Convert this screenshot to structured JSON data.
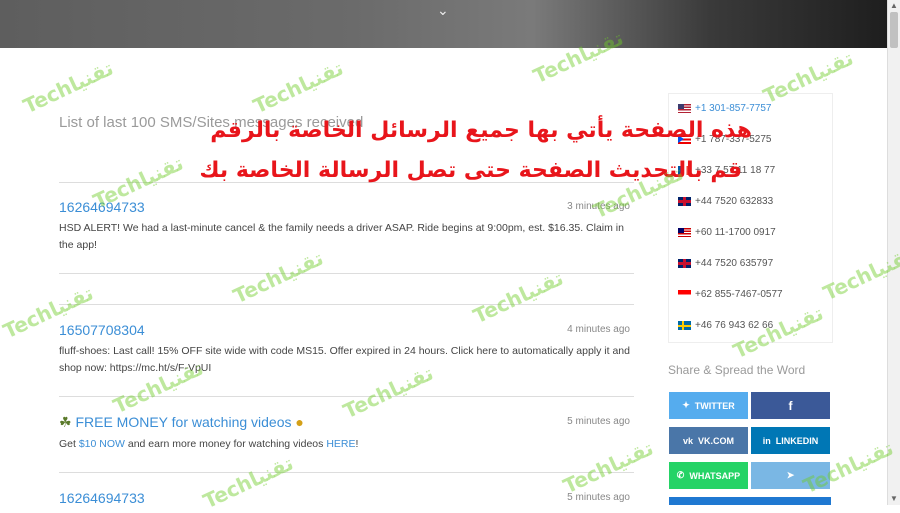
{
  "list_title": "List of last 100 SMS/Sites messages received",
  "overlay": {
    "line1": "هذه الصفحة يأتي بها جميع الرسائل الخاصة بالرقم",
    "line2": "قم بالتحديث الصفحة حتى تصل الرسالة الخاصة بك"
  },
  "messages": [
    {
      "number": "16264694733",
      "time": "3 minutes ago",
      "text": "HSD ALERT! We had a last-minute cancel & the family needs a driver ASAP. Ride begins at 9:00pm, est. $16.35. Claim in the app!"
    },
    {
      "number": "16507708304",
      "time": "4 minutes ago",
      "text": "fluff-shoes: Last call! 15% OFF site wide with code MS15. Offer expired in 24 hours. Click here to automatically apply it and shop now: https://mc.ht/s/F-VpUI"
    },
    {
      "title": "FREE MONEY for watching videos",
      "time": "5 minutes ago",
      "text_pre": "Get ",
      "link1": "$10 NOW",
      "text_mid": " and earn more money for watching videos ",
      "link2": "HERE",
      "text_post": "!"
    },
    {
      "number": "16264694733",
      "time": "5 minutes ago"
    }
  ],
  "sidebar_numbers": [
    {
      "number": "+1 301-857-7757",
      "flag": "us",
      "highlight": true
    },
    {
      "number": "+1 787-337-5275",
      "flag": "pr",
      "highlight": false
    },
    {
      "number": "+33 7 57 11 18 77",
      "flag": "fr",
      "highlight": false
    },
    {
      "number": "+44 7520 632833",
      "flag": "uk",
      "highlight": false
    },
    {
      "number": "+60 11-1700 0917",
      "flag": "my",
      "highlight": false
    },
    {
      "number": "+44 7520 635797",
      "flag": "uk",
      "highlight": false
    },
    {
      "number": "+62 855-7467-0577",
      "flag": "id",
      "highlight": false
    },
    {
      "number": "+46 76 943 62 66",
      "flag": "se",
      "highlight": false
    }
  ],
  "share": {
    "title": "Share & Spread the Word",
    "twitter": "TWITTER",
    "vk": "VK.COM",
    "linkedin": "LINKEDIN",
    "whatsapp": "WHATSAPP"
  },
  "colors": {
    "link": "#3b8ed6",
    "overlay_text": "#e8151b",
    "twitter": "#55acee",
    "facebook": "#3b5998",
    "vk": "#4a76a8",
    "linkedin": "#0077b5",
    "whatsapp": "#25d366",
    "telegram": "#7ab7e4"
  },
  "watermark": "Techتقنيا"
}
